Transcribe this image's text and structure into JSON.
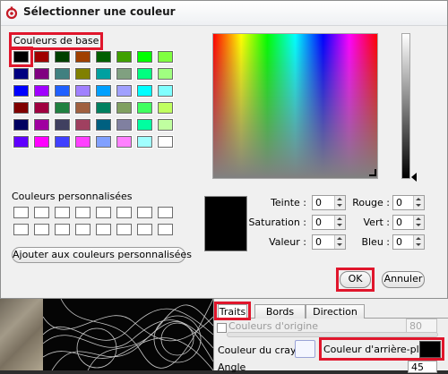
{
  "dialog": {
    "title": "Sélectionner une couleur",
    "app_icon": "gimp-wilber-icon"
  },
  "basic_colors": {
    "label": "Couleurs de base",
    "selected_index": 0,
    "swatches": [
      "#000000",
      "#a00000",
      "#004000",
      "#a04000",
      "#006000",
      "#40a000",
      "#00ff00",
      "#80ff40",
      "#000080",
      "#800080",
      "#408080",
      "#808000",
      "#00a0a0",
      "#80a080",
      "#00ff80",
      "#a0ff80",
      "#0000ff",
      "#a000ff",
      "#2060ff",
      "#a080ff",
      "#00a0ff",
      "#a0a0ff",
      "#00ffff",
      "#80ffff",
      "#800000",
      "#a00040",
      "#208040",
      "#a06040",
      "#008060",
      "#80a060",
      "#40ff60",
      "#c0ff60",
      "#000060",
      "#a000a0",
      "#404060",
      "#a04060",
      "#006080",
      "#8080a0",
      "#00ffa0",
      "#c0ffa0",
      "#6000ff",
      "#ff00ff",
      "#4040ff",
      "#ff40ff",
      "#80a0ff",
      "#ff80ff",
      "#a0ffff",
      "#ffffff"
    ]
  },
  "custom_colors": {
    "label": "Couleurs personnalisées",
    "add_button": "Ajouter aux couleurs personnalisées",
    "swatches": [
      "#ffffff",
      "#ffffff",
      "#ffffff",
      "#ffffff",
      "#ffffff",
      "#ffffff",
      "#ffffff",
      "#ffffff",
      "#ffffff",
      "#ffffff",
      "#ffffff",
      "#ffffff",
      "#ffffff",
      "#ffffff",
      "#ffffff",
      "#ffffff"
    ]
  },
  "preview": {
    "color": "#000000"
  },
  "fields": {
    "hue": {
      "label": "Teinte :",
      "value": "0"
    },
    "saturation": {
      "label": "Saturation :",
      "value": "0"
    },
    "value": {
      "label": "Valeur :",
      "value": "0"
    },
    "red": {
      "label": "Rouge :",
      "value": "0"
    },
    "green": {
      "label": "Vert :",
      "value": "0"
    },
    "blue": {
      "label": "Bleu :",
      "value": "0"
    }
  },
  "buttons": {
    "ok": "OK",
    "cancel": "Annuler"
  },
  "panel": {
    "tabs": [
      "Traits",
      "Bords",
      "Direction"
    ],
    "active_tab": "Traits",
    "origin_colors": {
      "label": "Couleurs d'origine",
      "value": "80",
      "checked": false,
      "enabled": false
    },
    "pen_color": {
      "label": "Couleur du crayon",
      "color": "#f4f6ff"
    },
    "background_color": {
      "label": "Couleur d'arrière-plan",
      "color": "#000000"
    },
    "angle": {
      "label": "Angle",
      "value": "45"
    }
  },
  "colors": {
    "highlight": "#e0162c",
    "dialog_bg": "#f0f0f0"
  }
}
